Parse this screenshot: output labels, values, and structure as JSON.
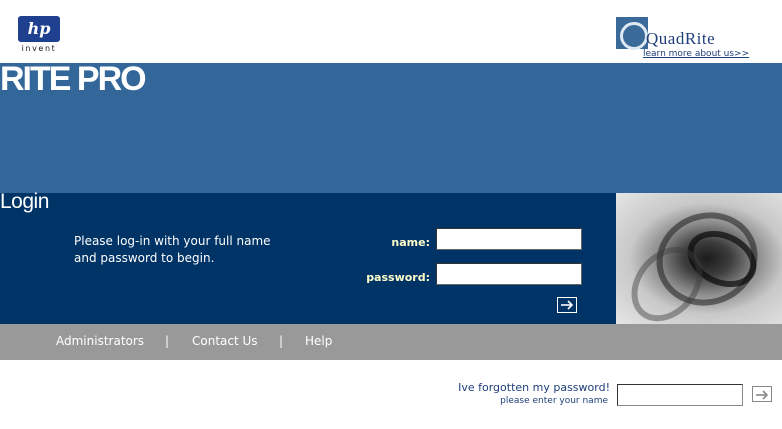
{
  "header": {
    "hp_logo_text": "hp",
    "hp_logo_tagline": "invent",
    "brand_logo_text": "QuadRite",
    "learn_more_link": "learn more about us>>"
  },
  "banner": {
    "title": "RITE PRO"
  },
  "login": {
    "heading": "Login",
    "instructions": "Please log-in with your full name and password to begin.",
    "name_label": "name:",
    "name_value": "",
    "password_label": "password:",
    "password_value": "",
    "submit_icon": "arrow-right-icon"
  },
  "nav": {
    "items": [
      "Administrators",
      "Contact Us",
      "Help"
    ],
    "separator": "|"
  },
  "forgot": {
    "title": "Ive forgotten my password!",
    "subtitle": "please enter your name",
    "input_value": "",
    "submit_icon": "arrow-right-icon"
  },
  "colors": {
    "banner": "#336699",
    "login_panel": "#003366",
    "navbar": "#999999",
    "label_yellow": "#ffffcc"
  }
}
